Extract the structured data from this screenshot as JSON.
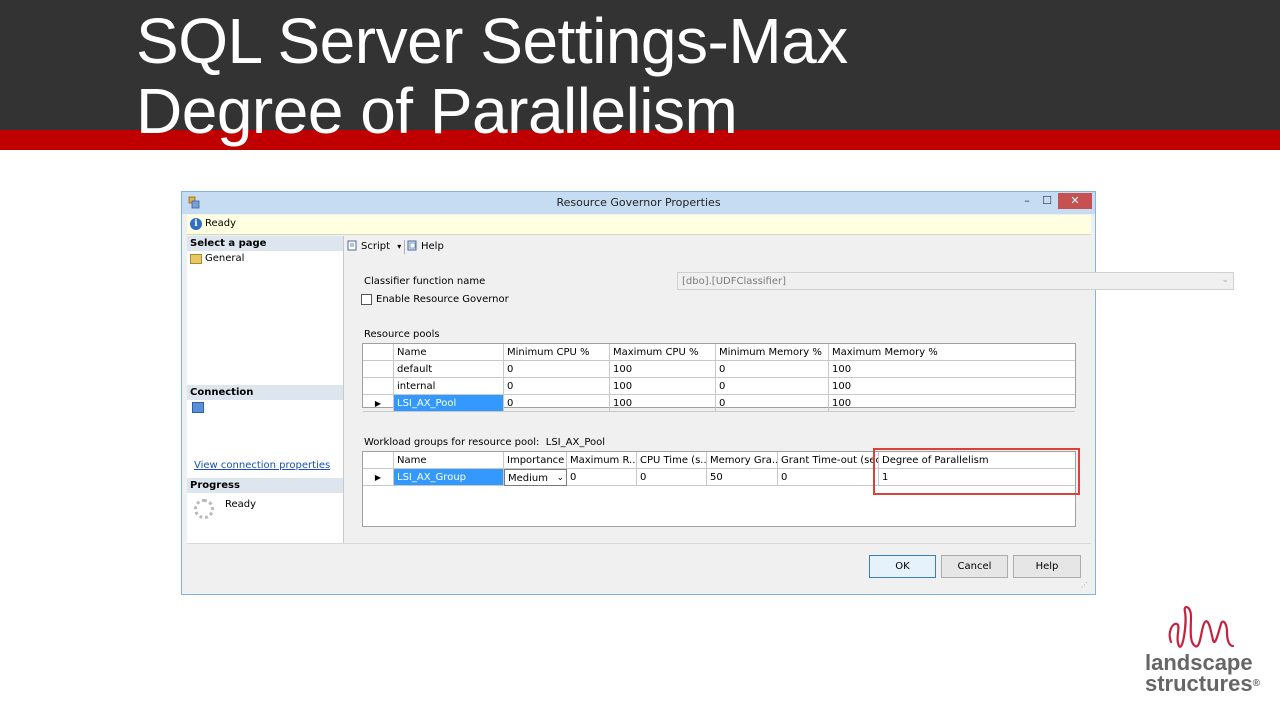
{
  "slide": {
    "title_line1": "SQL Server Settings-Max",
    "title_line2": "Degree of Parallelism"
  },
  "window": {
    "title": "Resource Governor Properties",
    "minimize_icon": "minimize-icon",
    "maximize_icon": "maximize-icon",
    "close_icon": "close-icon",
    "minimize_glyph": "–",
    "maximize_glyph": "☐",
    "close_glyph": "✕"
  },
  "status": {
    "text": "Ready",
    "icon": "info-icon"
  },
  "left_pane": {
    "select_page_header": "Select a page",
    "pages": [
      {
        "label": "General",
        "icon": "general-page-icon"
      }
    ],
    "connection_header": "Connection",
    "view_connection_link": "View connection properties",
    "progress_header": "Progress",
    "progress_status": "Ready"
  },
  "toolbar": {
    "script_label": "Script",
    "script_dropdown_glyph": "▾",
    "help_label": "Help"
  },
  "form": {
    "classifier_label": "Classifier function name",
    "classifier_value": "[dbo].[UDFClassifier]",
    "enable_governor_label": "Enable Resource Governor",
    "enable_governor_checked": false
  },
  "resource_pools": {
    "section_label": "Resource pools",
    "columns": [
      "Name",
      "Minimum CPU %",
      "Maximum CPU %",
      "Minimum Memory %",
      "Maximum Memory %"
    ],
    "rows": [
      [
        "default",
        "0",
        "100",
        "0",
        "100"
      ],
      [
        "internal",
        "0",
        "100",
        "0",
        "100"
      ],
      [
        "LSI_AX_Pool",
        "0",
        "100",
        "0",
        "100"
      ]
    ],
    "selected_row_index": 2
  },
  "workload_groups": {
    "section_label": "Workload groups for resource pool:",
    "pool_name": "LSI_AX_Pool",
    "columns": [
      "Name",
      "Importance",
      "Maximum R...",
      "CPU Time (s...",
      "Memory Gra...",
      "Grant Time-out (sec)",
      "Degree of Parallelism"
    ],
    "rows": [
      [
        "LSI_AX_Group",
        "Medium",
        "0",
        "0",
        "50",
        "0",
        "1"
      ]
    ],
    "highlighted_column": "Degree of Parallelism",
    "highlight_color": "#d9413a"
  },
  "footer": {
    "ok_label": "OK",
    "cancel_label": "Cancel",
    "help_label": "Help"
  },
  "logo": {
    "line1": "landscape",
    "line2": "structures",
    "registered": "®",
    "brand_color": "#c4223f"
  },
  "colors": {
    "header_dark": "#333333",
    "header_red": "#c00000",
    "selection_blue": "#3399ff"
  }
}
